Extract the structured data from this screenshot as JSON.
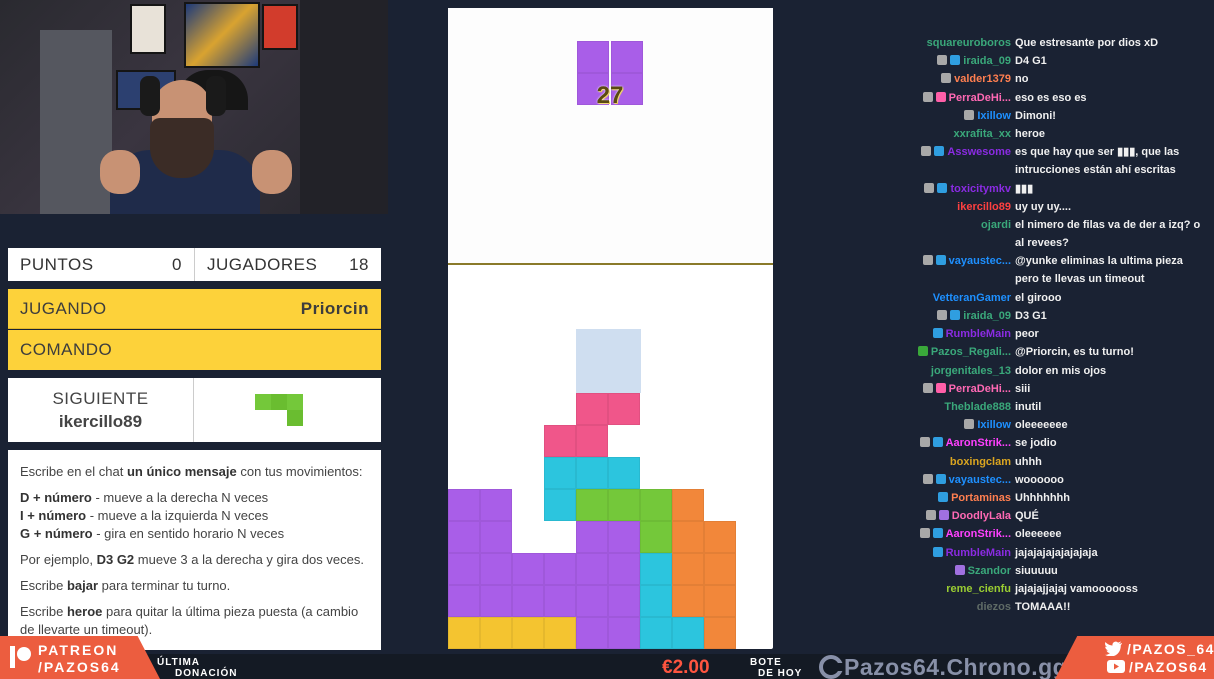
{
  "score": {
    "points_label": "PUNTOS",
    "points_value": "0",
    "players_label": "JUGADORES",
    "players_value": "18"
  },
  "status": {
    "playing_label": "JUGANDO",
    "playing_user": "Priorcin",
    "command_label": "COMANDO"
  },
  "next": {
    "label": "SIGUIENTE",
    "user": "ikercillo89"
  },
  "instructions": {
    "intro_pre": "Escribe en el chat ",
    "intro_bold": "un único mensaje",
    "intro_post": " con tus movimientos:",
    "cmd_d_key": "D + número",
    "cmd_d_text": " - mueve a la derecha N veces",
    "cmd_i_key": "I + número",
    "cmd_i_text": " - mueve a la izquierda N veces",
    "cmd_g_key": "G + número",
    "cmd_g_text": " - gira en sentido horario N veces",
    "example_pre": "Por ejemplo, ",
    "example_bold": "D3 G2",
    "example_post": " mueve 3 a la derecha y gira dos veces.",
    "bajar_pre": "Escribe ",
    "bajar_bold": "bajar",
    "bajar_post": " para terminar tu turno.",
    "heroe_pre": "Escribe ",
    "heroe_bold": "heroe",
    "heroe_post": " para quitar la última pieza puesta (a cambio de llevarte un timeout)."
  },
  "game": {
    "counter": "27"
  },
  "chat": [
    {
      "user": "squareuroboros",
      "color": "#3aa87a",
      "badges": [],
      "text": "Que estresante por dios xD"
    },
    {
      "user": "iraida_09",
      "color": "#3aa87a",
      "badges": [
        "mod",
        "sub"
      ],
      "text": "D4 G1"
    },
    {
      "user": "valder1379",
      "color": "#ff7f50",
      "badges": [
        "mod"
      ],
      "text": "no"
    },
    {
      "user": "PerraDeHi...",
      "color": "#ff69b4",
      "badges": [
        "mod",
        "heart"
      ],
      "text": "eso es eso es"
    },
    {
      "user": "Ixillow",
      "color": "#1e90ff",
      "badges": [
        "mod"
      ],
      "text": "Dimoni!"
    },
    {
      "user": "xxrafita_xx",
      "color": "#3aa87a",
      "badges": [],
      "text": "heroe"
    },
    {
      "user": "Asswesome",
      "color": "#8a2be2",
      "badges": [
        "mod",
        "sub"
      ],
      "text": "es que hay que ser ▮▮▮, que las intrucciones están ahí escritas"
    },
    {
      "user": "toxicitymkv",
      "color": "#8a2be2",
      "badges": [
        "mod",
        "sub"
      ],
      "text": "▮▮▮"
    },
    {
      "user": "ikercillo89",
      "color": "#ff4040",
      "badges": [],
      "text": "uy uy uy...."
    },
    {
      "user": "ojardi",
      "color": "#3aa87a",
      "badges": [],
      "text": "el nimero de filas va de der a izq? o al revees?"
    },
    {
      "user": "vayaustec...",
      "color": "#1e90ff",
      "badges": [
        "mod",
        "sub"
      ],
      "text": "@yunke eliminas la ultima pieza pero te llevas un timeout"
    },
    {
      "user": "VetteranGamer",
      "color": "#1e90ff",
      "badges": [],
      "text": "el girooo"
    },
    {
      "user": "iraida_09",
      "color": "#3aa87a",
      "badges": [
        "mod",
        "sub"
      ],
      "text": "D3 G1"
    },
    {
      "user": "RumbleMain",
      "color": "#8a2be2",
      "badges": [
        "sub"
      ],
      "text": "peor"
    },
    {
      "user": "Pazos_Regali...",
      "color": "#3aa87a",
      "badges": [
        "bot"
      ],
      "text": "@Priorcin, es tu turno!"
    },
    {
      "user": "jorgenitales_13",
      "color": "#3aa87a",
      "badges": [],
      "text": "dolor en mis ojos"
    },
    {
      "user": "PerraDeHi...",
      "color": "#ff69b4",
      "badges": [
        "mod",
        "heart"
      ],
      "text": "siii"
    },
    {
      "user": "Theblade888",
      "color": "#3aa87a",
      "badges": [],
      "text": "inutil"
    },
    {
      "user": "Ixillow",
      "color": "#1e90ff",
      "badges": [
        "mod"
      ],
      "text": "oleeeeeee"
    },
    {
      "user": "AaronStrik...",
      "color": "#ff40ff",
      "badges": [
        "mod",
        "sub"
      ],
      "text": "se jodio"
    },
    {
      "user": "boxingclam",
      "color": "#daa520",
      "badges": [],
      "text": "uhhh"
    },
    {
      "user": "vayaustec...",
      "color": "#1e90ff",
      "badges": [
        "mod",
        "sub"
      ],
      "text": "woooooo"
    },
    {
      "user": "Portaminas",
      "color": "#ff7f50",
      "badges": [
        "sub"
      ],
      "text": "Uhhhhhhh"
    },
    {
      "user": "DoodlyLala",
      "color": "#ff69b4",
      "badges": [
        "mod",
        "gem"
      ],
      "text": "QUÉ"
    },
    {
      "user": "AaronStrik...",
      "color": "#ff40ff",
      "badges": [
        "mod",
        "sub"
      ],
      "text": "oleeeeee"
    },
    {
      "user": "RumbleMain",
      "color": "#8a2be2",
      "badges": [
        "sub"
      ],
      "text": "jajajajajajajajaja"
    },
    {
      "user": "Szandor",
      "color": "#3aa87a",
      "badges": [
        "gem"
      ],
      "text": "siuuuuu"
    },
    {
      "user": "reme_cienfu",
      "color": "#9acd32",
      "badges": [],
      "text": "jajajajjajaj vamoooooss"
    },
    {
      "user": "diezos",
      "color": "#5f6b66",
      "badges": [],
      "text": "TOMAAA!!"
    }
  ],
  "footer": {
    "patreon_line1": "PATREON",
    "patreon_line2": "/PAZOS64",
    "last_donation_1": "ÚLTIMA",
    "last_donation_2": "DONACIÓN",
    "donation_amount": "€2.00",
    "pot_1": "BOTE",
    "pot_2": "DE HOY",
    "chrono": "Pazos64.Chrono.gg",
    "twitter": "/PAZOS_64",
    "youtube": "/PAZOS64"
  },
  "colors": {
    "yellow": "#fdd23a",
    "purple": "#a95ee8",
    "pink": "#f0568a",
    "cyan": "#2cc5de",
    "green": "#74c83a",
    "orange": "#f2873a",
    "gold": "#f4c430",
    "ghost": "#cfdef0"
  }
}
